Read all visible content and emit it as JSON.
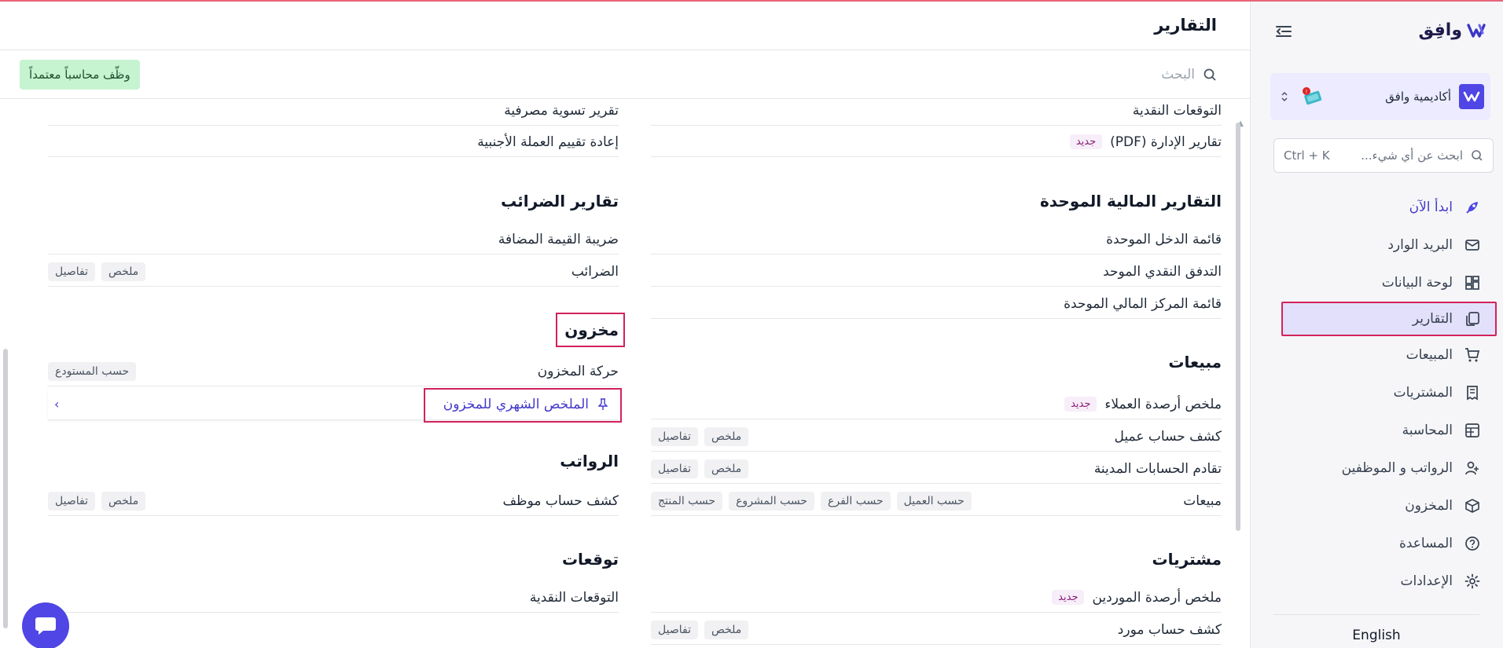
{
  "sidebar": {
    "brand": "وافِق",
    "org_name": "أكاديمية وافق",
    "search": {
      "placeholder": "ابحث عن أي شيء...",
      "shortcut": "Ctrl + K"
    },
    "items": [
      {
        "label": "ابدأ الآن",
        "icon": "rocket-icon"
      },
      {
        "label": "البريد الوارد",
        "icon": "inbox-icon"
      },
      {
        "label": "لوحة البيانات",
        "icon": "dashboard-icon"
      },
      {
        "label": "التقارير",
        "icon": "reports-icon"
      },
      {
        "label": "المبيعات",
        "icon": "cart-icon"
      },
      {
        "label": "المشتريات",
        "icon": "receipt-icon"
      },
      {
        "label": "المحاسبة",
        "icon": "ledger-icon"
      },
      {
        "label": "الرواتب و الموظفين",
        "icon": "users-icon"
      },
      {
        "label": "المخزون",
        "icon": "box-icon"
      },
      {
        "label": "المساعدة",
        "icon": "help-icon"
      },
      {
        "label": "الإعدادات",
        "icon": "gear-icon"
      }
    ],
    "language": "English"
  },
  "header": {
    "title": "التقارير"
  },
  "toolbar": {
    "search_placeholder": "البحث",
    "hire_button": "وظّف محاسباً معتمداً"
  },
  "right_column": {
    "top_rows": [
      {
        "label": "التوقعات النقدية"
      },
      {
        "label": "تقارير الإدارة (PDF)",
        "badge": "جديد"
      }
    ],
    "consolidated": {
      "title": "التقارير المالية الموحدة",
      "rows": [
        "قائمة الدخل الموحدة",
        "التدفق النقدي الموحد",
        "قائمة المركز المالي الموحدة"
      ]
    },
    "sales": {
      "title": "مبيعات",
      "rows": [
        {
          "label": "ملخص أرصدة العملاء",
          "badge": "جديد"
        },
        {
          "label": "كشف حساب عميل",
          "chips": [
            "ملخص",
            "تفاصيل"
          ]
        },
        {
          "label": "تقادم الحسابات المدينة",
          "chips": [
            "ملخص",
            "تفاصيل"
          ]
        },
        {
          "label": "مبيعات",
          "chips": [
            "حسب العميل",
            "حسب الفرع",
            "حسب المشروع",
            "حسب المنتج"
          ]
        }
      ]
    },
    "purchases": {
      "title": "مشتريات",
      "rows": [
        {
          "label": "ملخص أرصدة الموردين",
          "badge": "جديد"
        },
        {
          "label": "كشف حساب مورد",
          "chips": [
            "ملخص",
            "تفاصيل"
          ]
        }
      ]
    }
  },
  "left_column": {
    "top_rows": [
      "تقرير تسوية مصرفية",
      "إعادة تقييم العملة الأجنبية"
    ],
    "tax": {
      "title": "تقارير الضرائب",
      "rows": [
        {
          "label": "ضريبة القيمة المضافة"
        },
        {
          "label": "الضرائب",
          "chips": [
            "ملخص",
            "تفاصيل"
          ]
        }
      ]
    },
    "inventory": {
      "title": "مخزون",
      "movement": {
        "label": "حركة المخزون",
        "chips": [
          "حسب المستودع"
        ]
      },
      "monthly": {
        "label": "الملخص الشهري للمخزون",
        "chevron": "›"
      }
    },
    "payroll": {
      "title": "الرواتب",
      "rows": [
        {
          "label": "كشف حساب موظف",
          "chips": [
            "ملخص",
            "تفاصيل"
          ]
        }
      ]
    },
    "forecasts": {
      "title": "توقعات",
      "rows": [
        {
          "label": "التوقعات النقدية"
        }
      ]
    }
  }
}
